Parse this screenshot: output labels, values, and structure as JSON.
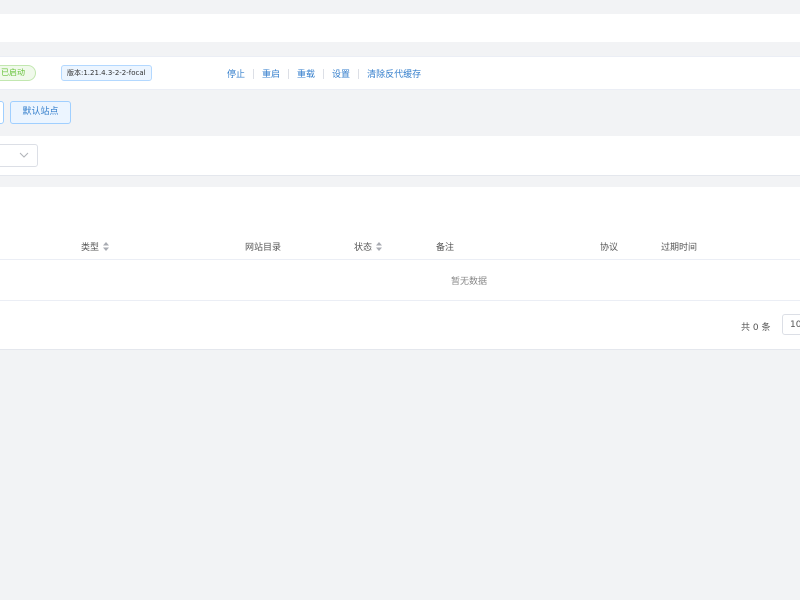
{
  "status_bar": {
    "status_badge": "已启动",
    "version": "版本:1.21.4.3-2-2-focal",
    "actions": [
      "停止",
      "重启",
      "重载",
      "设置",
      "清除反代缓存"
    ]
  },
  "toolbar": {
    "default_site_label": "默认站点"
  },
  "table": {
    "columns": [
      {
        "label": "类型",
        "sortable": true
      },
      {
        "label": "网站目录",
        "sortable": false
      },
      {
        "label": "状态",
        "sortable": true
      },
      {
        "label": "备注",
        "sortable": false
      },
      {
        "label": "协议",
        "sortable": false
      },
      {
        "label": "过期时间",
        "sortable": false
      }
    ],
    "empty_text": "暂无数据"
  },
  "pagination": {
    "total_text": "共 0 条",
    "page_size": "10"
  },
  "colors": {
    "accent": "#337ecc",
    "success": "#67c23a",
    "background": "#f2f3f5"
  }
}
